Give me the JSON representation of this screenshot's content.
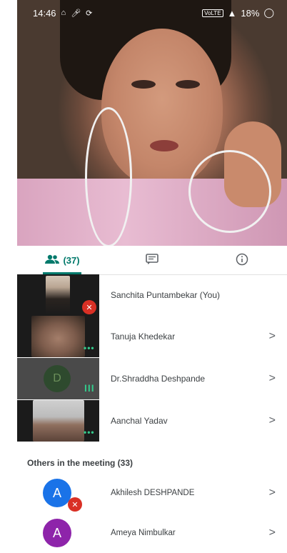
{
  "status_bar": {
    "time": "14:46",
    "battery": "18%"
  },
  "tabs": {
    "people_count": "(37)"
  },
  "participants": [
    {
      "name": "Sanchita Puntambekar (You)"
    },
    {
      "name": "Tanuja Khedekar",
      "chevron": ">"
    },
    {
      "name": "Dr.Shraddha Deshpande",
      "initial": "D",
      "chevron": ">"
    },
    {
      "name": "Aanchal Yadav",
      "chevron": ">"
    }
  ],
  "others_section": {
    "title": "Others in the meeting (33)"
  },
  "others": [
    {
      "name": "Akhilesh DESHPANDE",
      "initial": "A",
      "color": "#1a73e8",
      "chevron": ">"
    },
    {
      "name": "Ameya Nimbulkar",
      "initial": "A",
      "color": "#8e24aa",
      "chevron": ">"
    }
  ],
  "colors": {
    "accent": "#00796b",
    "mute": "#d93025",
    "talk": "#34c98b"
  },
  "icons": [
    "people-icon",
    "chat-icon",
    "info-icon",
    "mic-off-icon",
    "chevron-right-icon"
  ]
}
